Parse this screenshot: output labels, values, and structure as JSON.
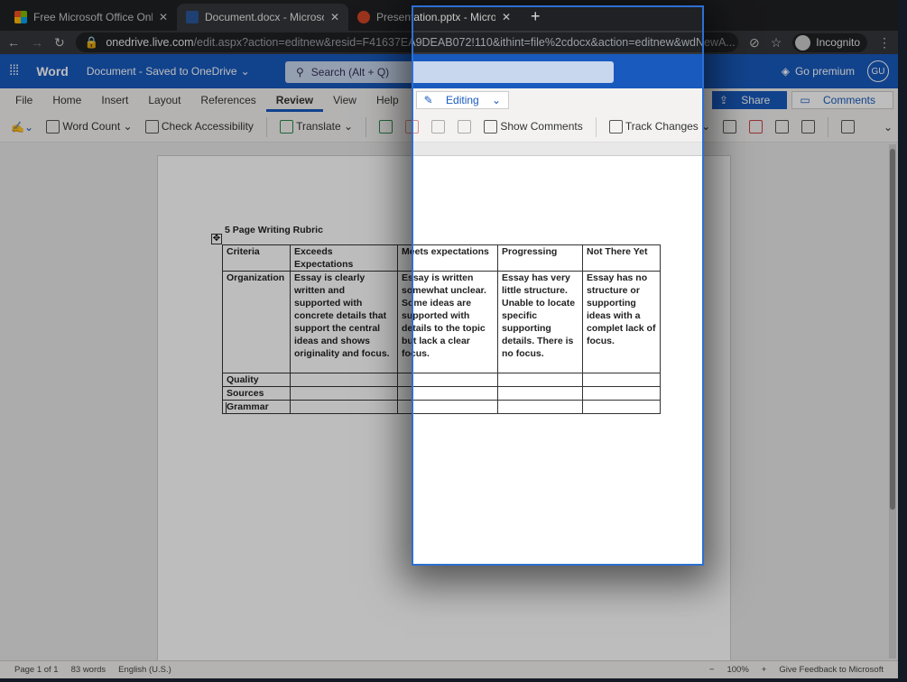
{
  "browser": {
    "tabs": [
      {
        "title": "Free Microsoft Office Online",
        "color": "#f25022"
      },
      {
        "title": "Document.docx - Microsoft Word",
        "color": "#2b579a",
        "active": true
      },
      {
        "title": "Presentation.pptx - Microsoft",
        "color": "#d24726"
      }
    ],
    "new_tab": "+",
    "url_host": "onedrive.live.com",
    "url_path": "/edit.aspx?action=editnew&resid=F41637EA9DEAB072!110&ithint=file%2cdocx&action=editnew&wdNewA...",
    "incognito": "Incognito"
  },
  "word": {
    "app": "Word",
    "doc_title": "Document - Saved to OneDrive",
    "search": "Search (Alt + Q)",
    "premium": "Go premium",
    "avatar": "GU",
    "ribbon_tabs": [
      "File",
      "Home",
      "Insert",
      "Layout",
      "References",
      "Review",
      "View",
      "Help"
    ],
    "editing": "Editing",
    "share": "Share",
    "comments": "Comments",
    "tools": {
      "word_count": "Word Count",
      "check_accessibility": "Check Accessibility",
      "translate": "Translate",
      "show_comments": "Show Comments",
      "track_changes": "Track Changes"
    }
  },
  "doc": {
    "title": "5 Page Writing Rubric",
    "headers": [
      "Criteria",
      "Exceeds Expectations",
      "Meets expectations",
      "Progressing",
      "Not There Yet"
    ],
    "rows": [
      [
        "Organization",
        "Essay is clearly written and supported with concrete details that support the central ideas and shows originality and focus.",
        "Essay is written somewhat unclear. Some ideas are supported with details to the topic but lack a clear focus.",
        "Essay has very little structure. Unable to locate specific supporting details. There is no focus.",
        "Essay has no structure or supporting ideas with a complet lack of focus."
      ],
      [
        "Quality",
        "",
        "",
        "",
        ""
      ],
      [
        "Sources",
        "",
        "",
        "",
        ""
      ],
      [
        "Grammar",
        "",
        "",
        "",
        ""
      ]
    ]
  },
  "status": {
    "page": "Page 1 of 1",
    "words": "83 words",
    "language": "English (U.S.)",
    "zoom": "100%",
    "feedback": "Give Feedback to Microsoft"
  }
}
